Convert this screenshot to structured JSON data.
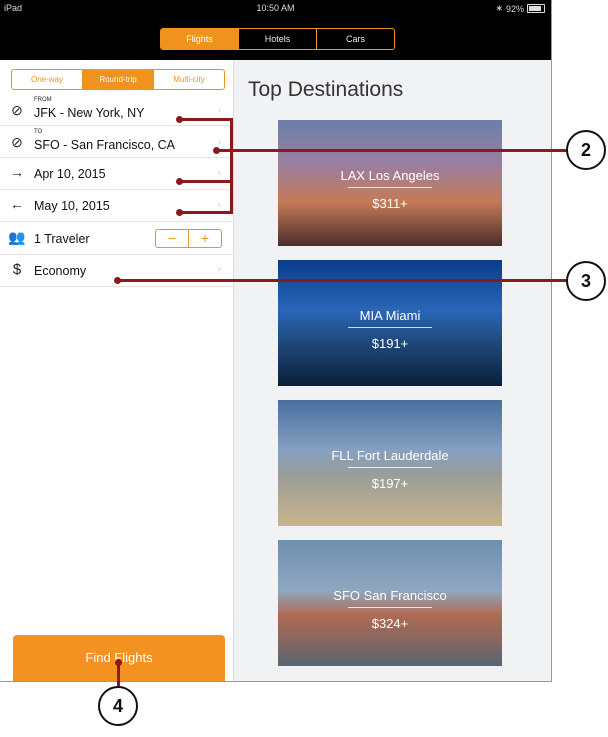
{
  "status": {
    "left": "iPad",
    "time": "10:50 AM",
    "battery": "92%"
  },
  "tabs": [
    {
      "label": "Flights"
    },
    {
      "label": "Hotels"
    },
    {
      "label": "Cars"
    }
  ],
  "trip_types": [
    {
      "label": "One-way"
    },
    {
      "label": "Round-trip"
    },
    {
      "label": "Multi-city"
    }
  ],
  "form": {
    "from_label": "FROM",
    "from_value": "JFK - New York, NY",
    "to_label": "TO",
    "to_value": "SFO - San Francisco, CA",
    "depart": "Apr 10, 2015",
    "return": "May 10, 2015",
    "travelers": "1 Traveler",
    "stepper_minus": "−",
    "stepper_plus": "+",
    "cabin": "Economy"
  },
  "find_button": "Find Flights",
  "destinations_title": "Top Destinations",
  "destinations": [
    {
      "name": "LAX Los Angeles",
      "price": "$311+"
    },
    {
      "name": "MIA Miami",
      "price": "$191+"
    },
    {
      "name": "FLL Fort Lauderdale",
      "price": "$197+"
    },
    {
      "name": "SFO San Francisco",
      "price": "$324+"
    }
  ],
  "callouts": {
    "c2": "2",
    "c3": "3",
    "c4": "4"
  }
}
